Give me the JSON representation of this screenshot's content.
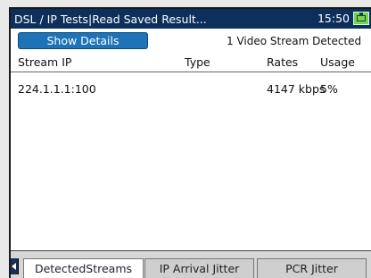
{
  "window": {
    "title": "DSL / IP Tests|Read Saved Result...",
    "time": "15:50",
    "battery_icon": "battery-icon"
  },
  "toolbar": {
    "show_details_label": "Show Details",
    "status_text": "1 Video Stream Detected"
  },
  "table": {
    "headers": [
      "Stream IP",
      "Type",
      "Rates",
      "Usage"
    ],
    "rows": [
      {
        "stream_ip": "224.1.1.1:100",
        "type": "",
        "rates": "4147 kbps",
        "usage": "5%"
      }
    ]
  },
  "tabs": [
    {
      "label": "DetectedStreams",
      "active": true
    },
    {
      "label": "IP Arrival Jitter",
      "active": false
    },
    {
      "label": "PCR Jitter",
      "active": false
    }
  ],
  "colors": {
    "title_bar": "#0c2f5c",
    "button": "#1d73b5",
    "battery": "#7ad34a"
  }
}
